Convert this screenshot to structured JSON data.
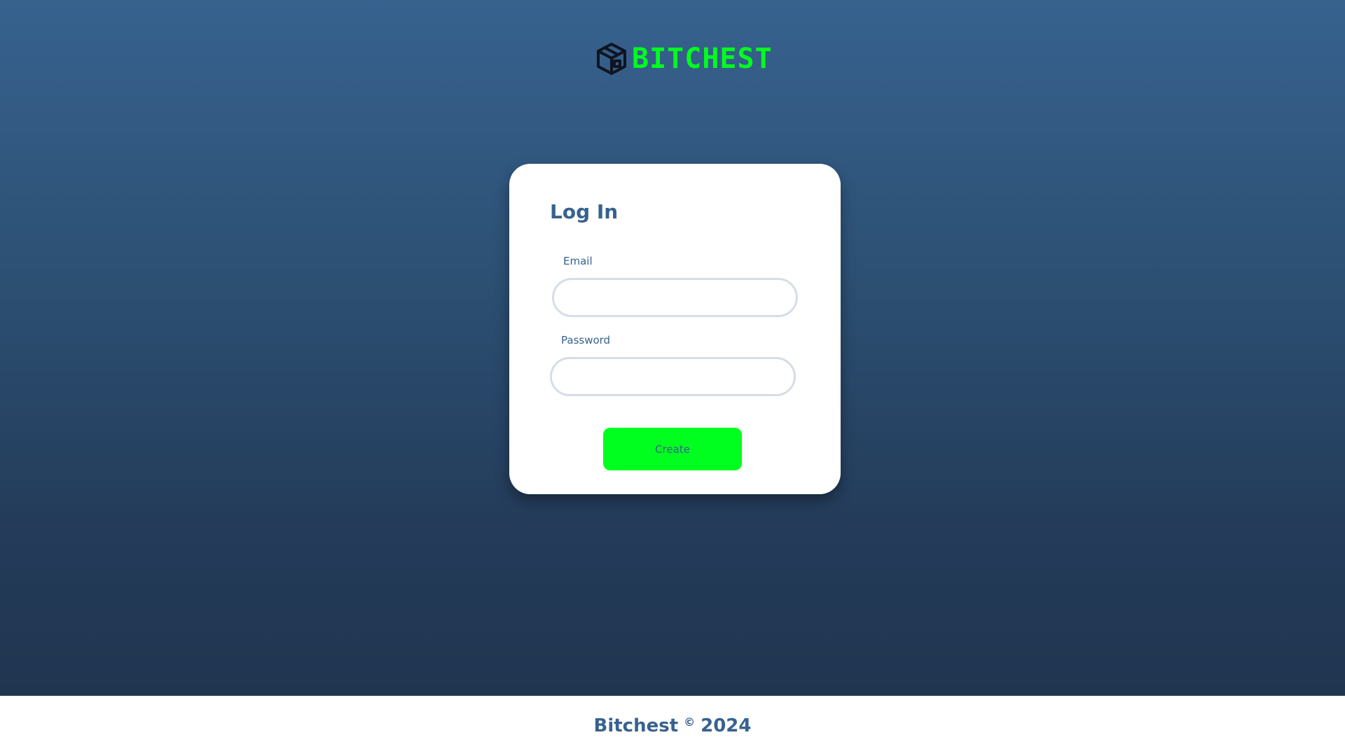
{
  "header": {
    "brand_name": "BITCHEST",
    "brand_icon": "treasure-chest-cube-icon"
  },
  "login_card": {
    "title": "Log In",
    "email_label": "Email",
    "email_value": "",
    "password_label": "Password",
    "password_value": "",
    "submit_label": "Create"
  },
  "footer": {
    "company": "Bitchest",
    "copyright_symbol": "©",
    "year": "2024"
  },
  "colors": {
    "accent_green": "#00ff1e",
    "brand_blue": "#37628f",
    "background_top": "#37628f",
    "background_bottom": "#203550",
    "input_border": "#d5dde6"
  }
}
